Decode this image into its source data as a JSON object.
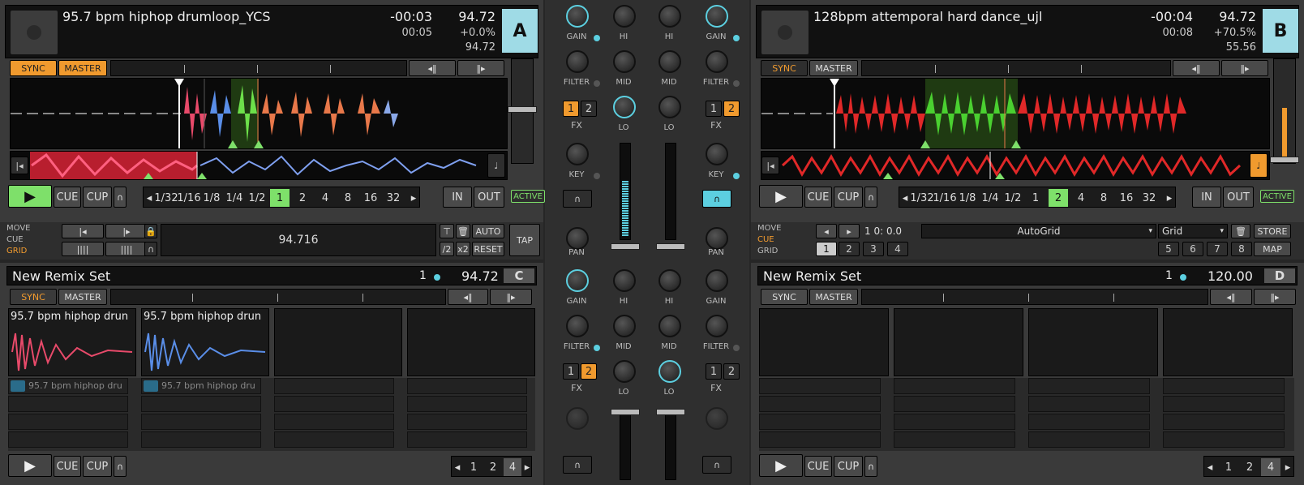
{
  "deckA": {
    "title": "95.7 bpm hiphop drumloop_YCS",
    "time_remaining": "-00:03",
    "time_elapsed": "00:05",
    "bpm": "94.72",
    "pitch": "+0.0%",
    "bpm_base": "94.72",
    "letter": "A",
    "sync": "SYNC",
    "master": "MASTER",
    "loop_sizes": [
      "1/32",
      "1/16",
      "1/8",
      "1/4",
      "1/2",
      "1",
      "2",
      "4",
      "8",
      "16",
      "32"
    ],
    "loop_active": "1",
    "in": "IN",
    "out": "OUT",
    "active": "ACTIVE",
    "cue": "CUE",
    "cup": "CUP",
    "mode_move": "MOVE",
    "mode_cue": "CUE",
    "mode_grid": "GRID",
    "grid_bpm": "94.716",
    "auto": "AUTO",
    "reset": "RESET",
    "half": "/2",
    "double": "x2",
    "tap": "TAP"
  },
  "deckB": {
    "title": "128bpm attemporal hard dance_ujl",
    "time_remaining": "-00:04",
    "time_elapsed": "00:08",
    "bpm": "94.72",
    "pitch": "+70.5%",
    "bpm_base": "55.56",
    "letter": "B",
    "sync": "SYNC",
    "master": "MASTER",
    "loop_sizes": [
      "1/32",
      "1/16",
      "1/8",
      "1/4",
      "1/2",
      "1",
      "2",
      "4",
      "8",
      "16",
      "32"
    ],
    "loop_active": "2",
    "in": "IN",
    "out": "OUT",
    "active": "ACTIVE",
    "cue": "CUE",
    "cup": "CUP",
    "mode_move": "MOVE",
    "mode_cue": "CUE",
    "mode_grid": "GRID",
    "position": "1 0: 0.0",
    "autogrid": "AutoGrid",
    "grid": "Grid",
    "store": "STORE",
    "map": "MAP",
    "hotcues": [
      "1",
      "2",
      "3",
      "4",
      "5",
      "6",
      "7",
      "8"
    ]
  },
  "deckC": {
    "title": "New Remix Set",
    "count": "1",
    "bpm": "94.72",
    "letter": "C",
    "sync": "SYNC",
    "master": "MASTER",
    "slot1": "95.7 bpm hiphop drun",
    "slot2": "95.7 bpm hiphop drun",
    "sample1": "95.7 bpm hiphop dru",
    "sample2": "95.7 bpm hiphop dru",
    "cue": "CUE",
    "cup": "CUP",
    "pages": [
      "1",
      "2",
      "4"
    ]
  },
  "deckD": {
    "title": "New Remix Set",
    "count": "1",
    "bpm": "120.00",
    "letter": "D",
    "sync": "SYNC",
    "master": "MASTER",
    "cue": "CUE",
    "cup": "CUP",
    "pages": [
      "1",
      "2",
      "4"
    ]
  },
  "mixer": {
    "gain": "GAIN",
    "hi": "HI",
    "mid": "MID",
    "lo": "LO",
    "filter": "FILTER",
    "fx": "FX",
    "key": "KEY",
    "pan": "PAN",
    "fx1": "1",
    "fx2": "2"
  },
  "colors": {
    "accent": "#f09a2e",
    "cyan": "#5ccfe0",
    "play": "#7ee06a"
  }
}
